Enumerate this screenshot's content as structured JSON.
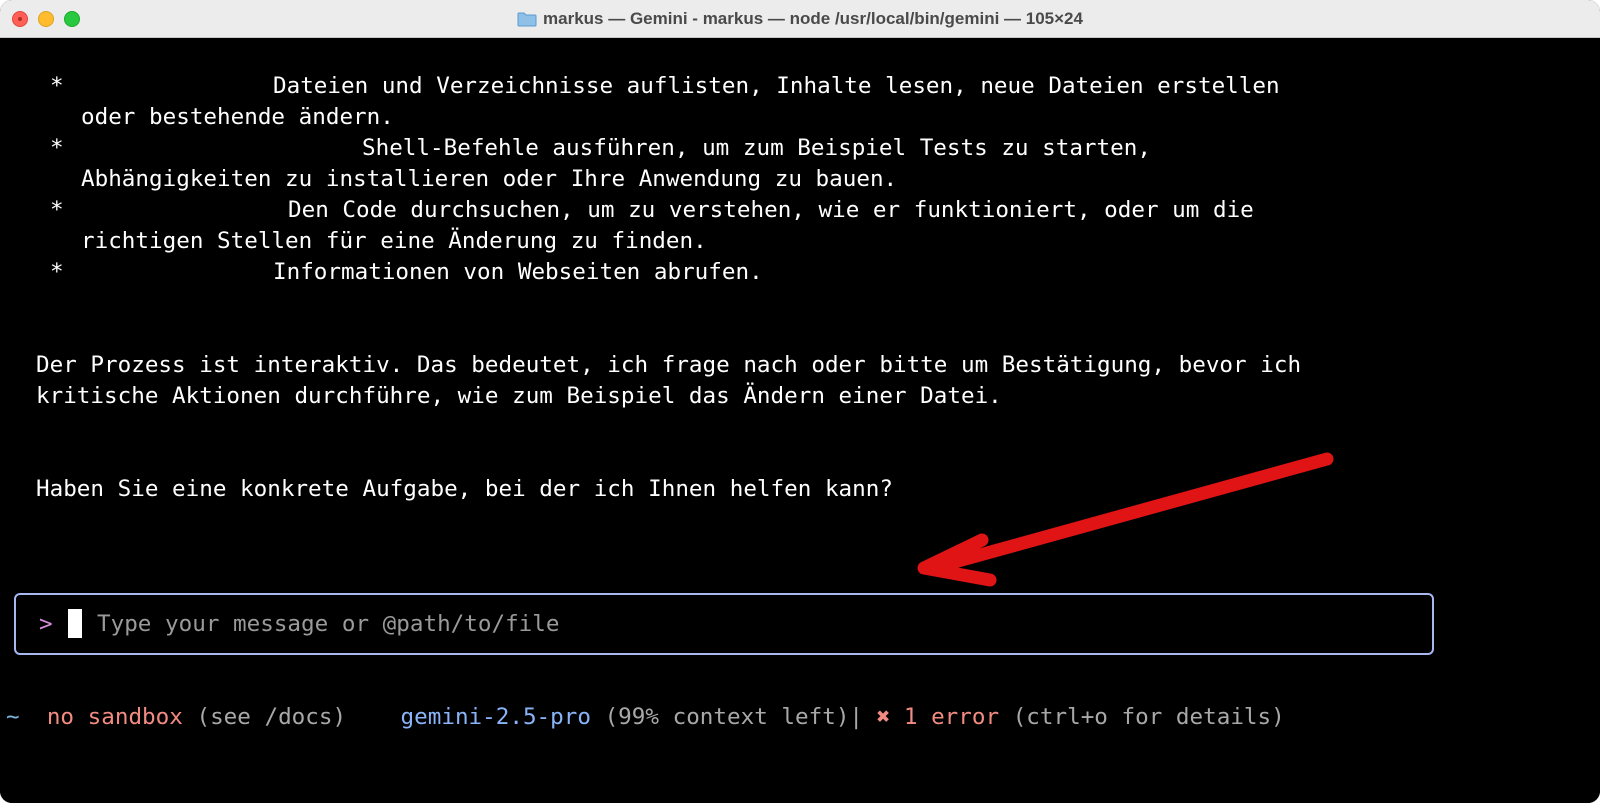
{
  "window": {
    "title": "markus —  Gemini - markus  — node /usr/local/bin/gemini — 105×24"
  },
  "content": {
    "bullet_symbol": "*",
    "bullets": [
      {
        "first": "Dateien und Verzeichnisse auflisten, Inhalte lesen, neue Dateien erstellen",
        "second": "oder bestehende ändern."
      },
      {
        "first": "Shell-Befehle ausführen, um zum Beispiel Tests zu starten,",
        "second": "Abhängigkeiten zu installieren oder Ihre Anwendung zu bauen."
      },
      {
        "first": "Den Code durchsuchen, um zu verstehen, wie er funktioniert, oder um die",
        "second": "richtigen Stellen für eine Änderung zu finden."
      },
      {
        "first": "Informationen von Webseiten abrufen."
      }
    ],
    "paragraph_lines": [
      "Der Prozess ist interaktiv. Das bedeutet, ich frage nach oder bitte um Bestätigung, bevor ich",
      "kritische Aktionen durchführe, wie zum Beispiel das Ändern einer Datei."
    ],
    "question": "Haben Sie eine konkrete Aufgabe, bei der ich Ihnen helfen kann?"
  },
  "input": {
    "prompt": ">",
    "placeholder": "Type your message or @path/to/file"
  },
  "status": {
    "cwd": "~",
    "sandbox": "no sandbox",
    "sandbox_hint": "(see /docs)",
    "model": "gemini-2.5-pro",
    "context": "(99% context left)|",
    "error_icon": "✖",
    "errors": "1 error",
    "error_hint": "(ctrl+o for details)"
  },
  "colors": {
    "background": "#000000",
    "text": "#ffffff",
    "input_border": "#a7b8f0",
    "model": "#8ab4f8",
    "error": "#f28b82",
    "annotation_arrow": "#e01414"
  }
}
